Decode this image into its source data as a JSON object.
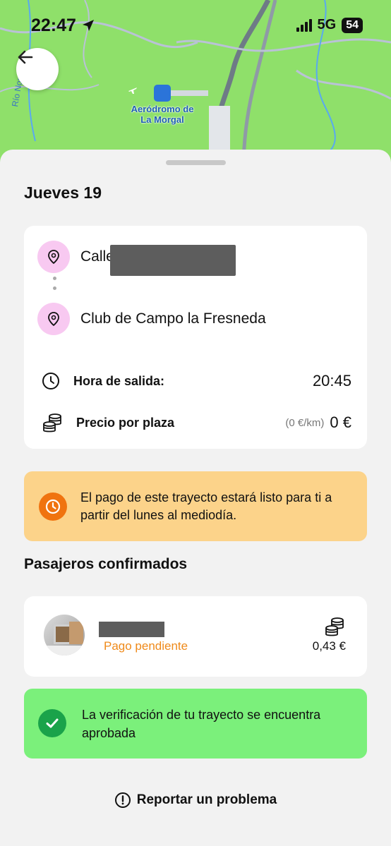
{
  "status_bar": {
    "time": "22:47",
    "network": "5G",
    "battery": "54"
  },
  "map": {
    "airport_name": "Aeródromo de La Morgal",
    "river_label": "Río Nora"
  },
  "trip": {
    "day_title": "Jueves 19",
    "origin": "Calle",
    "destination": "Club de Campo la Fresneda",
    "departure_label": "Hora de salida:",
    "departure_time": "20:45",
    "price_label": "Precio por plaza",
    "price_per_km": "(0 €/km)",
    "price": "0 €"
  },
  "payment_notice": "El pago de este trayecto estará listo para ti a partir del lunes al mediodía.",
  "passengers": {
    "section_title": "Pasajeros confirmados",
    "items": [
      {
        "status": "Pago pendiente",
        "amount": "0,43 €"
      }
    ]
  },
  "verification_notice": "La verificación de tu trayecto se encuentra aprobada",
  "report_problem": "Reportar un problema",
  "colors": {
    "map_green": "#8fe06a",
    "pin_pink": "#f8c9f1",
    "payment_banner": "#fcd38a",
    "payment_icon": "#f0730f",
    "pending_orange": "#ef8a1a",
    "verify_banner": "#7bf07b",
    "verify_icon": "#1aa34a"
  }
}
